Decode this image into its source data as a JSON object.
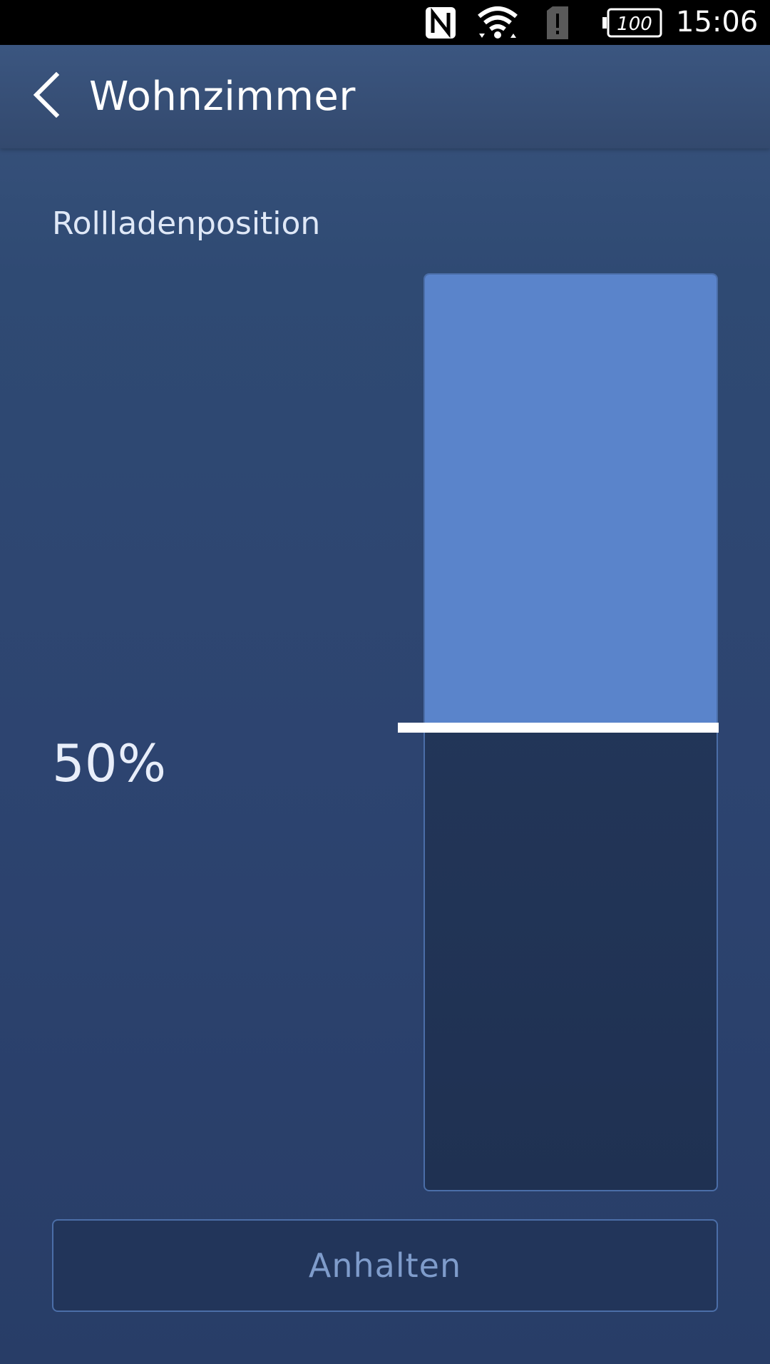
{
  "status_bar": {
    "battery_level": "100",
    "time": "15:06",
    "icons": [
      "nfc-icon",
      "wifi-icon",
      "sim-alert-icon",
      "battery-icon"
    ]
  },
  "header": {
    "title": "Wohnzimmer",
    "back_icon": "chevron-left-icon"
  },
  "shutter": {
    "label": "Rollladenposition",
    "position_text": "50%",
    "position_fraction": 0.5
  },
  "actions": {
    "stop_label": "Anhalten"
  },
  "colors": {
    "fill": "#5a84cb",
    "track": "#22355a",
    "border": "#4b6ea8",
    "handle": "#ffffff",
    "button_text": "#7f9ccb"
  }
}
